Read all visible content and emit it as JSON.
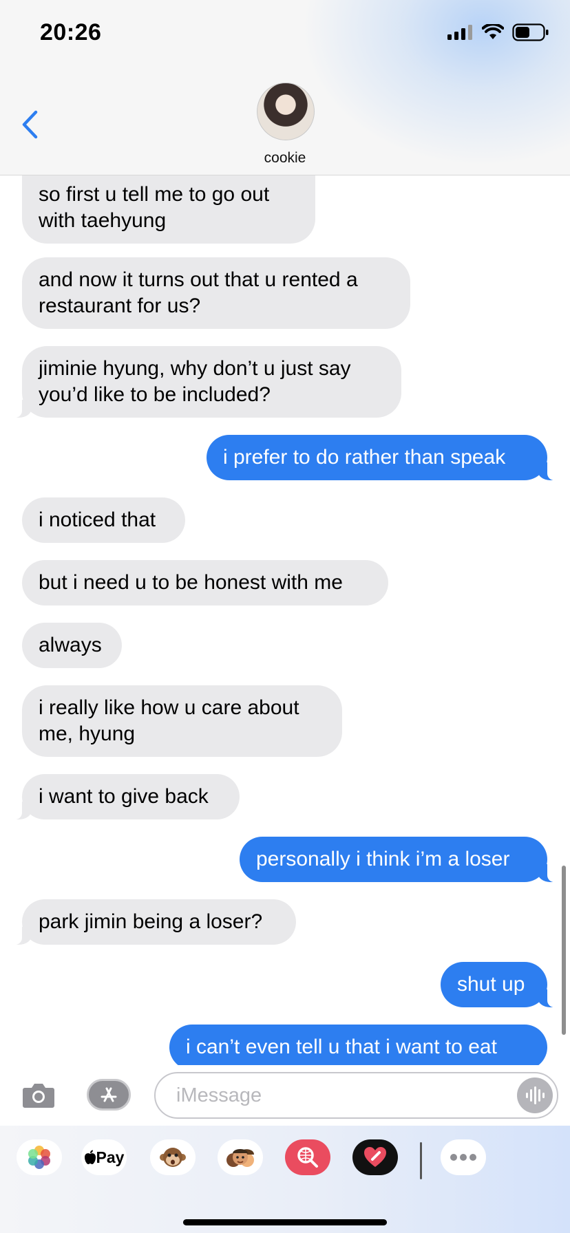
{
  "status_bar": {
    "time": "20:26"
  },
  "header": {
    "contact_name": "cookie"
  },
  "messages": [
    {
      "from": "them",
      "text": "so first u tell me to go out with taehyung"
    },
    {
      "from": "them",
      "text": "and now it turns out that u rented a restaurant for us?"
    },
    {
      "from": "them",
      "text": "jiminie hyung, why don’t u just say you’d like to be included?"
    },
    {
      "from": "me",
      "text": "i prefer to do rather than speak"
    },
    {
      "from": "them",
      "text": "i noticed that"
    },
    {
      "from": "them",
      "text": "but i need u to be honest with me"
    },
    {
      "from": "them",
      "text": "always"
    },
    {
      "from": "them",
      "text": "i really like how u care about me, hyung"
    },
    {
      "from": "them",
      "text": "i want to give back"
    },
    {
      "from": "me",
      "text": "personally i think i’m a loser"
    },
    {
      "from": "them",
      "text": "park jimin being a loser?"
    },
    {
      "from": "me",
      "text": "shut up"
    },
    {
      "from": "me",
      "text": "i can’t even tell u that i want to eat"
    }
  ],
  "input": {
    "placeholder": "iMessage"
  },
  "app_drawer": {
    "apple_pay_label": "Pay",
    "apps": [
      "photos-icon",
      "apple-pay-icon",
      "monkey-memoji-icon",
      "memoji-stickers-icon",
      "image-search-icon",
      "digital-touch-icon",
      "more-icon"
    ]
  },
  "colors": {
    "outgoing_bubble": "#2d7ef0",
    "incoming_bubble": "#e9e9eb",
    "accent": "#2d7ef0"
  }
}
